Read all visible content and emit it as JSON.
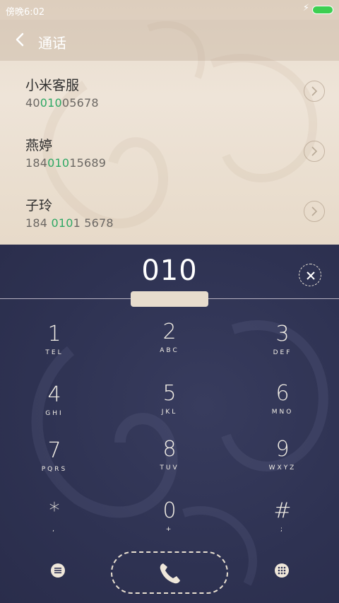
{
  "status_bar": {
    "time": "傍晚6:02",
    "charging_icon": "⚡"
  },
  "header": {
    "title": "通话"
  },
  "results": [
    {
      "name": "小米客服",
      "number_pre": "40",
      "number_match": "010",
      "number_post": "05678"
    },
    {
      "name": "燕婷",
      "number_pre": "184",
      "number_match": "010",
      "number_post": "15689"
    },
    {
      "name": "子玲",
      "number_pre": "184 ",
      "number_match": "010",
      "number_post": "1 5678"
    }
  ],
  "dialpad": {
    "entry": "010",
    "keys": [
      {
        "digit": "1",
        "sub": "TEL"
      },
      {
        "digit": "2",
        "sub": "ABC"
      },
      {
        "digit": "3",
        "sub": "DEF"
      },
      {
        "digit": "4",
        "sub": "GHI"
      },
      {
        "digit": "5",
        "sub": "JKL"
      },
      {
        "digit": "6",
        "sub": "MNO"
      },
      {
        "digit": "7",
        "sub": "PQRS"
      },
      {
        "digit": "8",
        "sub": "TUV"
      },
      {
        "digit": "9",
        "sub": "WXYZ"
      },
      {
        "digit": "*",
        "sub": ","
      },
      {
        "digit": "0",
        "sub": "+"
      },
      {
        "digit": "#",
        "sub": ";"
      }
    ]
  },
  "colors": {
    "match_highlight": "#2ea864",
    "pad_background": "#2f3354",
    "battery": "#3dcf52"
  },
  "icons": {
    "back": "back-arrow-icon",
    "row_detail": "chevron-right-circle-icon",
    "clear": "clear-x-icon",
    "menu": "menu-icon",
    "call": "phone-icon",
    "keypad_toggle": "keypad-grid-icon"
  }
}
